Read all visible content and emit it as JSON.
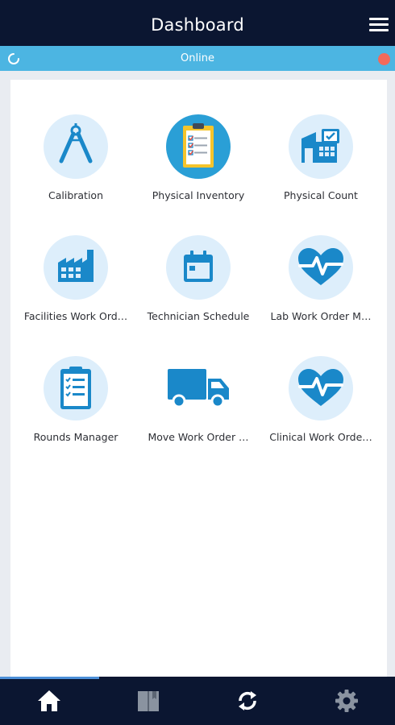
{
  "header": {
    "title": "Dashboard"
  },
  "status": {
    "text": "Online"
  },
  "tiles": [
    {
      "label": "Calibration",
      "icon": "compass-icon"
    },
    {
      "label": "Physical Inventory",
      "icon": "clipboard-checklist-icon"
    },
    {
      "label": "Physical Count",
      "icon": "warehouse-icon"
    },
    {
      "label": "Facilities Work Ord…",
      "icon": "factory-icon"
    },
    {
      "label": "Technician Schedule",
      "icon": "calendar-icon"
    },
    {
      "label": "Lab Work Order M…",
      "icon": "heart-pulse-icon"
    },
    {
      "label": "Rounds Manager",
      "icon": "checklist-icon"
    },
    {
      "label": "Move Work Order …",
      "icon": "truck-icon"
    },
    {
      "label": "Clinical Work Orde…",
      "icon": "heart-pulse-icon"
    }
  ],
  "nav": [
    {
      "icon": "home-icon"
    },
    {
      "icon": "book-icon"
    },
    {
      "icon": "sync-icon"
    },
    {
      "icon": "settings-gear-icon"
    }
  ],
  "colors": {
    "header": "#0b1631",
    "status_bar": "#4cb5e2",
    "icon_blue": "#1a88c9",
    "icon_circle": "#ddeefb",
    "offline_dot": "#f26a5a"
  }
}
